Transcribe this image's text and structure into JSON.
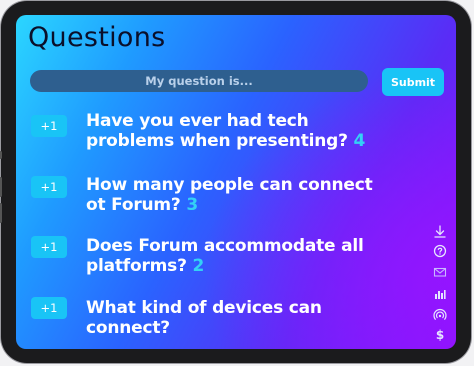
{
  "header": {
    "title": "Questions"
  },
  "ask": {
    "placeholder": "My question is...",
    "submit_label": "Submit"
  },
  "questions": [
    {
      "vote_label": "+1",
      "line1": "Have you ever had tech",
      "line2": "problems when presenting?",
      "count": "4"
    },
    {
      "vote_label": "+1",
      "line1": "How many people can connect",
      "line2": "ot Forum?",
      "count": "3"
    },
    {
      "vote_label": "+1",
      "line1": "Does Forum accommodate all",
      "line2": "platforms?",
      "count": "2"
    },
    {
      "vote_label": "+1",
      "line1": "What kind of devices can",
      "line2": "connect?",
      "count": ""
    }
  ],
  "side_toolbar": {
    "icons": [
      "download-icon",
      "help-icon",
      "mail-icon",
      "bar-chart-icon",
      "broadcast-icon",
      "dollar-icon"
    ],
    "dollar_glyph": "$"
  },
  "colors": {
    "accent": "#19c4f6",
    "count": "#33d1f5",
    "input_bg": "#2e5f8f",
    "title": "#0a0f2a"
  }
}
